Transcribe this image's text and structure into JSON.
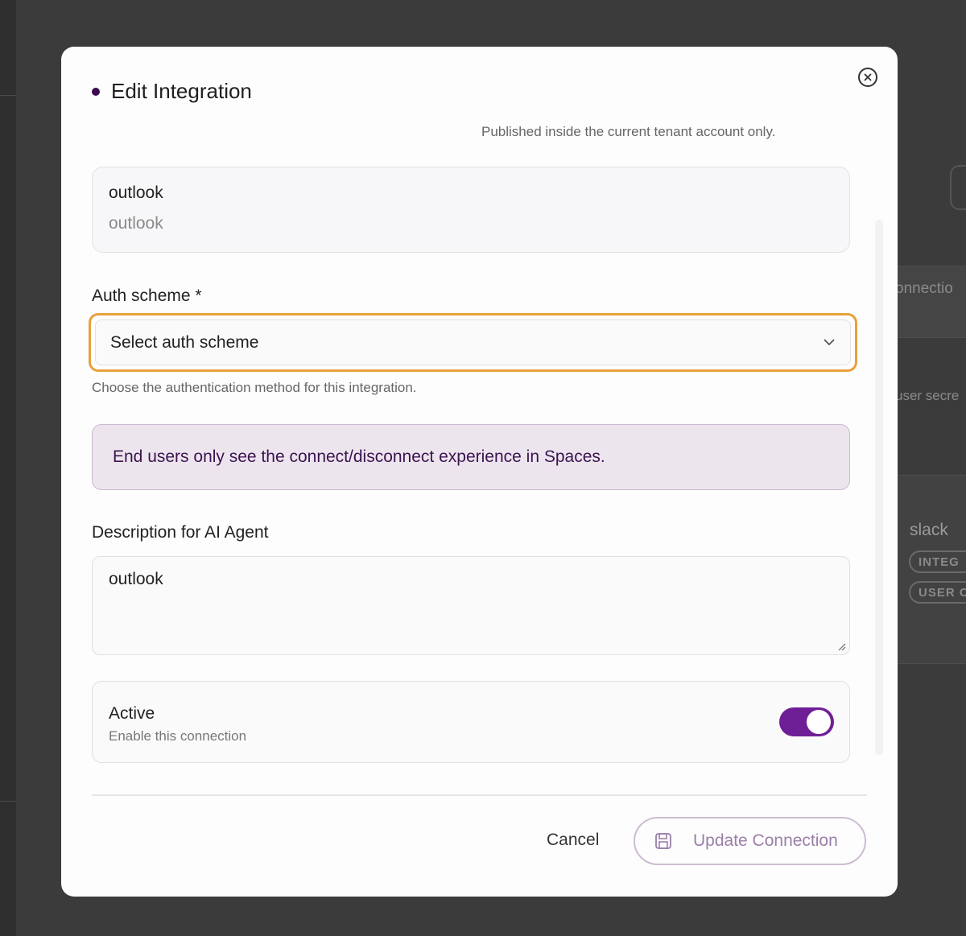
{
  "background": {
    "partial_texts": [
      "onnectio",
      "user secre",
      "slack"
    ],
    "pills": [
      "INTEG",
      "USER C"
    ]
  },
  "modal": {
    "title": "Edit Integration",
    "close_icon": "close-circle-icon",
    "top_hint": "Published inside the current tenant account only.",
    "integration": {
      "name": "outlook",
      "subname": "outlook"
    },
    "auth": {
      "label": "Auth scheme *",
      "placeholder": "Select auth scheme",
      "help": "Choose the authentication method for this integration."
    },
    "notice": "End users only see the connect/disconnect experience in Spaces.",
    "description": {
      "label": "Description for AI Agent",
      "value": "outlook"
    },
    "active": {
      "title": "Active",
      "subtitle": "Enable this connection",
      "enabled": true
    },
    "footer": {
      "cancel_label": "Cancel",
      "update_label": "Update Connection"
    }
  },
  "colors": {
    "accent": "#6f1f96",
    "focus_ring": "#e8a13a",
    "notice_bg": "#ede5ee"
  }
}
